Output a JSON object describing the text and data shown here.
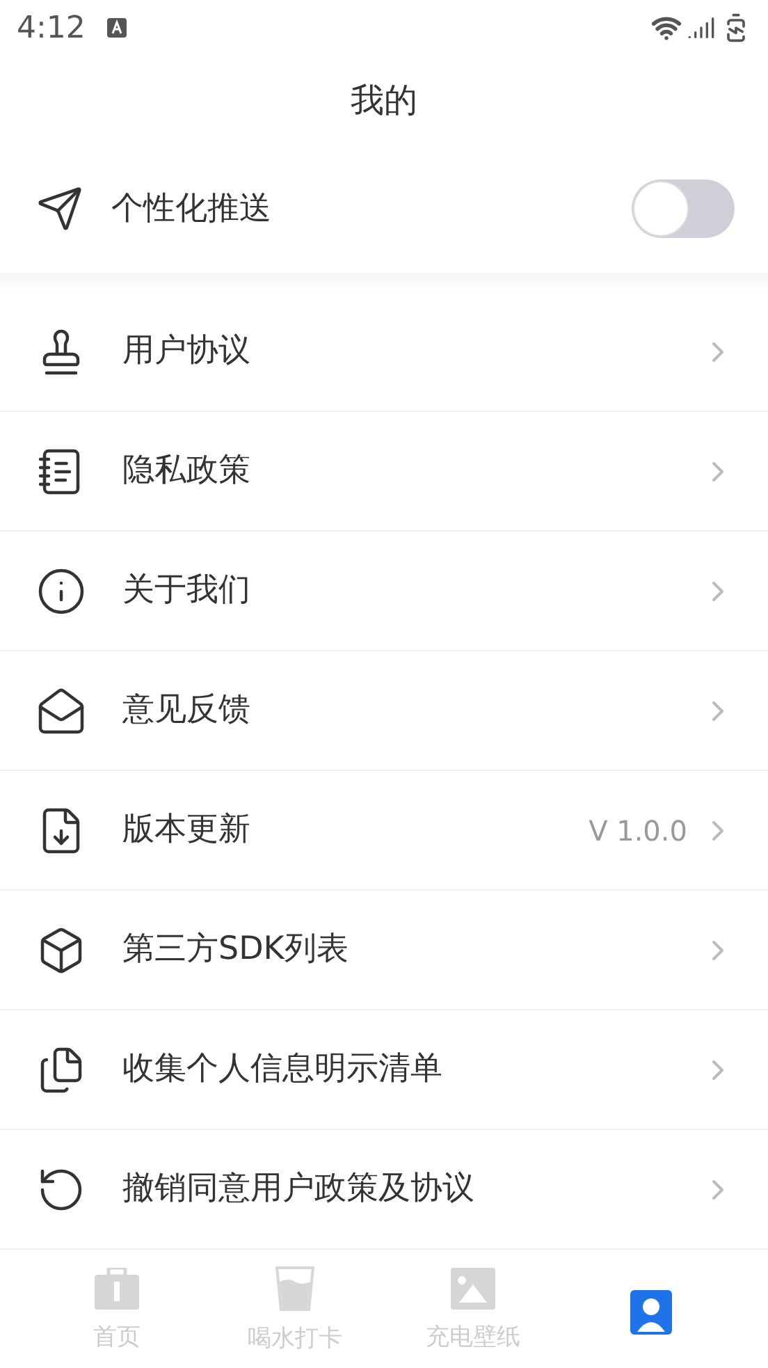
{
  "status_bar": {
    "time": "4:12"
  },
  "header": {
    "title": "我的"
  },
  "push_setting": {
    "label": "个性化推送",
    "on": false
  },
  "menu": [
    {
      "kind": "user-agreement",
      "label": "用户协议"
    },
    {
      "kind": "privacy",
      "label": "隐私政策"
    },
    {
      "kind": "about",
      "label": "关于我们"
    },
    {
      "kind": "feedback",
      "label": "意见反馈"
    },
    {
      "kind": "update",
      "label": "版本更新",
      "value": "V 1.0.0"
    },
    {
      "kind": "sdk",
      "label": "第三方SDK列表"
    },
    {
      "kind": "info-list",
      "label": "收集个人信息明示清单"
    },
    {
      "kind": "revoke",
      "label": "撤销同意用户政策及协议"
    }
  ],
  "tab_bar": [
    {
      "kind": "home",
      "label": "首页",
      "selected": false
    },
    {
      "kind": "water",
      "label": "喝水打卡",
      "selected": false
    },
    {
      "kind": "wallpaper",
      "label": "充电壁纸",
      "selected": false
    },
    {
      "kind": "profile",
      "selected": true
    }
  ]
}
